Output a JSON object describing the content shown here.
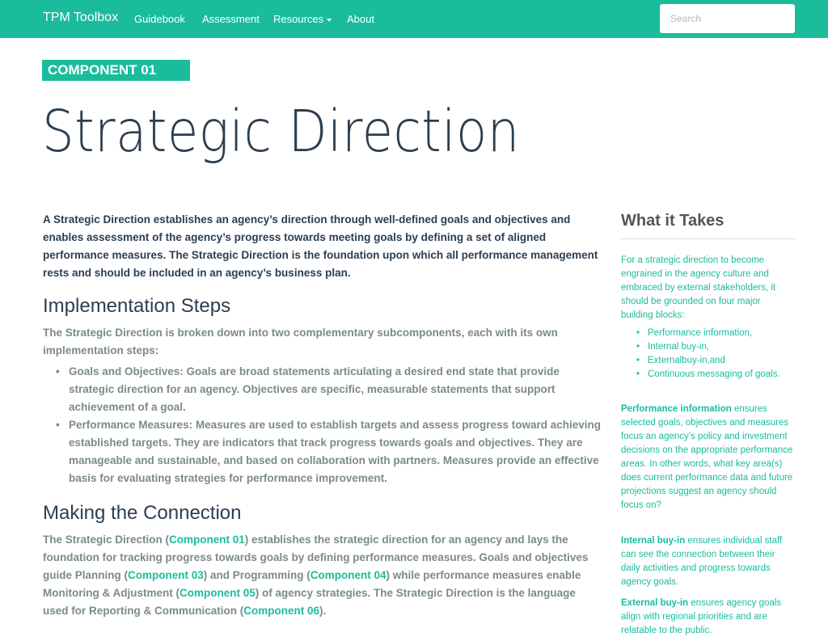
{
  "navbar": {
    "brand": "TPM Toolbox",
    "items": [
      "Guidebook",
      "Assessment",
      "Resources",
      "About"
    ],
    "search_placeholder": "Search",
    "color": "#1abc9c"
  },
  "header": {
    "badge": "COMPONENT 01",
    "title": "Strategic Direction"
  },
  "main": {
    "lead": "A Strategic Direction establishes an agency’s direction through well-defined goals and objectives and enables assessment of the agency’s progress towards meeting goals by defining a set of aligned performance measures. The Strategic Direction is the foundation upon which all performance management rests and should be included in an agency’s business plan.",
    "implementation": {
      "heading": "Implementation Steps",
      "intro": "The Strategic Direction is broken down into two complementary subcomponents, each with its own implementation steps:",
      "steps": [
        "Goals and Objectives: Goals are broad statements articulating a desired end state that provide strategic direction for an agency. Objectives are specific, measurable statements that support achievement of a goal.",
        "Performance Measures: Measures are used to establish targets and assess progress toward achieving established targets. They are indicators that track progress towards goals and objectives. They are manageable and sustainable, and based on collaboration with partners. Measures provide an effective basis for evaluating strategies for performance improvement."
      ]
    },
    "connection": {
      "heading": "Making the Connection",
      "t1": "The Strategic Direction (",
      "l1": "Component 01",
      "t2": ") establishes the strategic direction for an agency and lays the foundation for tracking progress towards goals by defining performance measures. Goals and objectives guide Planning (",
      "l2": "Component 03",
      "t3": ") and Programming (",
      "l3": "Component 04",
      "t4": ") while performance measures enable Monitoring & Adjustment (",
      "l4": "Component 05",
      "t5": ") of agency strategies. The Strategic Direction is the language used for Reporting & Communication (",
      "l5": "Component 06",
      "t6": ")."
    }
  },
  "sidebar": {
    "title": "What it Takes",
    "intro": "For a strategic direction to become engrained in the agency culture and embraced by external stakeholders, it should be grounded on four major building blocks:",
    "blocks": [
      "Performance information,",
      "Internal buy-in,",
      "Externalbuy-in,and",
      "Continuous messaging of goals."
    ],
    "perf_bold": "Performance information",
    "perf_text": " ensures selected goals, objectives and measures focus an agency’s policy and investment decisions on the appropriate performance areas. In other words, what key area(s) does current performance data and future projections suggest an agency should focus on?",
    "int_bold": "Internal buy-in",
    "int_text": " ensures individual staff can see the connection between their daily activities and progress towards agency goals.",
    "ext_bold": "External buy-in",
    "ext_text": " ensures agency goals align with regional priorities and are relatable to the public."
  }
}
